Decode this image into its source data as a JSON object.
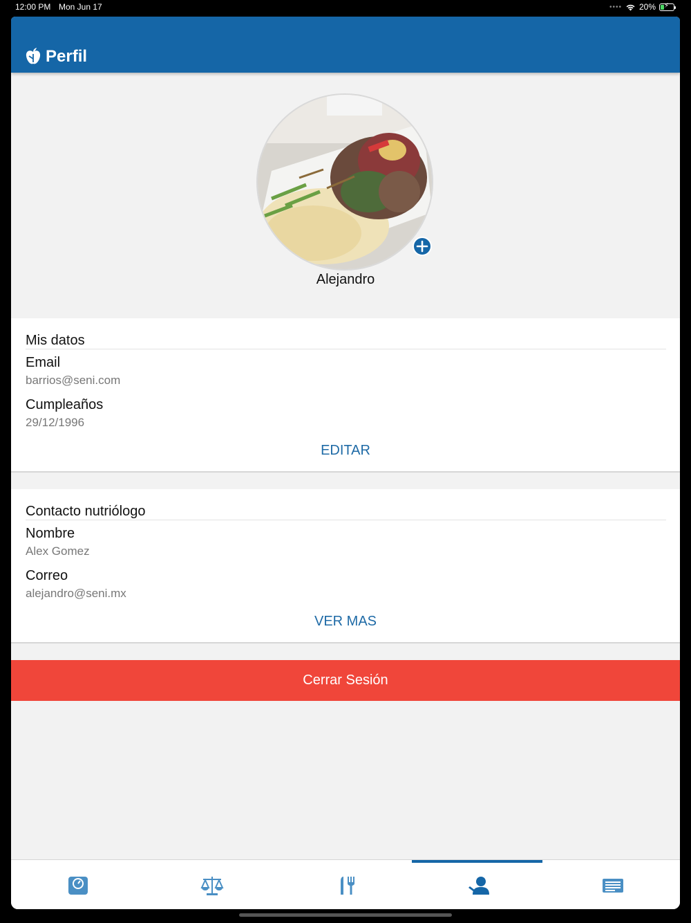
{
  "status_bar": {
    "time": "12:00 PM",
    "date": "Mon Jun 17",
    "battery": "20%"
  },
  "header": {
    "title": "Perfil",
    "color": "#1566a7"
  },
  "profile": {
    "name": "Alejandro"
  },
  "mis_datos": {
    "title": "Mis datos",
    "email_label": "Email",
    "email_value": "barrios@seni.com",
    "birthday_label": "Cumpleaños",
    "birthday_value": "29/12/1996",
    "action": "EDITAR"
  },
  "contacto": {
    "title": "Contacto nutriólogo",
    "name_label": "Nombre",
    "name_value": "Alex Gomez",
    "email_label": "Correo",
    "email_value": "alejandro@seni.mx",
    "action": "VER MAS"
  },
  "logout": {
    "label": "Cerrar Sesión",
    "color": "#f0463a"
  },
  "tabs": [
    {
      "icon": "scale-icon",
      "active": false
    },
    {
      "icon": "balance-icon",
      "active": false
    },
    {
      "icon": "utensils-icon",
      "active": false
    },
    {
      "icon": "user-icon",
      "active": true
    },
    {
      "icon": "news-icon",
      "active": false
    }
  ]
}
